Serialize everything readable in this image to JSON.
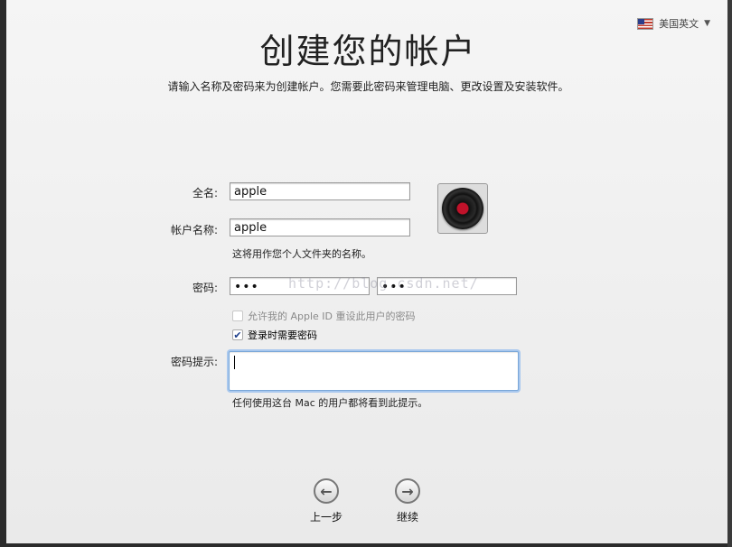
{
  "header": {
    "language": "美国英文",
    "title": "创建您的帐户",
    "subtitle": "请输入名称及密码来为创建帐户。您需要此密码来管理电脑、更改设置及安装软件。"
  },
  "form": {
    "fullname_label": "全名:",
    "fullname_value": "apple",
    "account_label": "帐户名称:",
    "account_value": "apple",
    "account_note": "这将用作您个人文件夹的名称。",
    "password_label": "密码:",
    "password_value": "•••",
    "password_verify_value": "•••",
    "apple_id_reset": {
      "label": "允许我的 Apple ID 重设此用户的密码",
      "checked": false,
      "enabled": false
    },
    "require_password_login": {
      "label": "登录时需要密码",
      "checked": true,
      "enabled": true
    },
    "hint_label": "密码提示:",
    "hint_value": "",
    "hint_note": "任何使用这台 Mac 的用户都将看到此提示。"
  },
  "watermark": "http://blog.csdn.net/",
  "nav": {
    "back_label": "上一步",
    "continue_label": "继续"
  }
}
